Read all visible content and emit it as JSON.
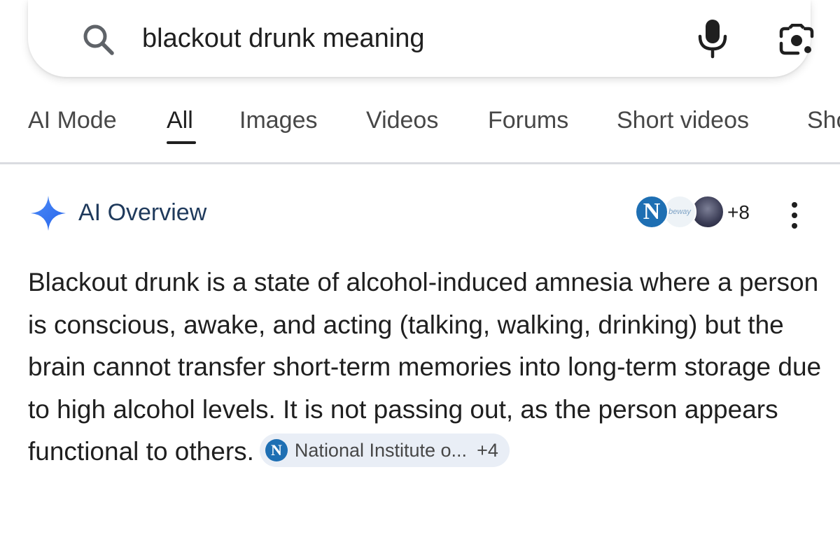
{
  "search": {
    "query": "blackout drunk meaning",
    "icons": [
      "search-icon",
      "microphone-icon",
      "google-lens-icon"
    ]
  },
  "tabs": [
    {
      "label": "AI Mode"
    },
    {
      "label": "All",
      "active": true
    },
    {
      "label": "Images"
    },
    {
      "label": "Videos"
    },
    {
      "label": "Forums"
    },
    {
      "label": "Short videos"
    },
    {
      "label": "Sho"
    }
  ],
  "ai_overview": {
    "title": "AI Overview",
    "sources": {
      "avatar_1_letter": "N",
      "avatar_2_text": "beway",
      "more_count": "+8"
    },
    "text": "Blackout drunk is a state of alcohol-induced amnesia where a person is conscious, awake, and acting (talking, walking, drinking) but the brain cannot transfer short-term memories into long-term storage due to high alcohol levels. It is not passing out, as the person appears functional to others.",
    "citation": {
      "icon_letter": "N",
      "label": "National Institute o...",
      "count": "+4"
    }
  },
  "colors": {
    "accent_blue": "#1e6fb3",
    "title_navy": "#1f3a5c",
    "chip_bg": "#e9eef6",
    "sparkle_blue": "#3b82f6"
  }
}
